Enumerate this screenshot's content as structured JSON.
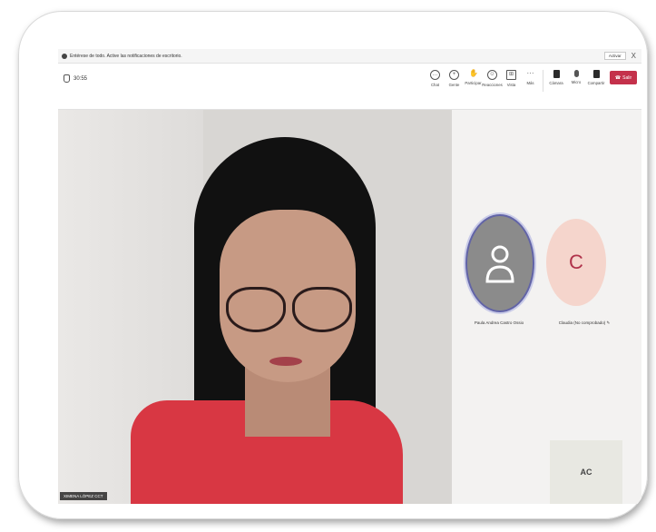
{
  "notification": {
    "text": "Entérese de todo. Active las notificaciones de escritorio.",
    "action_label": "Activar",
    "close_glyph": "X"
  },
  "call": {
    "timer": "30:55"
  },
  "toolbar": {
    "chat": "Chat",
    "raise": "Gente",
    "participants": "Participar",
    "reactions": "Reacciones",
    "view": "Vista",
    "more": "Más",
    "camera": "Cámara",
    "mic": "Micro",
    "share": "Compartir",
    "leave": "Salir"
  },
  "main_video": {
    "name_label": "XIMENA LÓPEZ CCT"
  },
  "participants": [
    {
      "name": "Paula Andrea Castro Ossio",
      "initial": ""
    },
    {
      "name": "Claudia (No comprobado)",
      "initial": "C"
    }
  ],
  "self_tile": {
    "initials": "AC"
  },
  "colors": {
    "accent": "#6264a7",
    "leave": "#c4314b"
  },
  "icons": [
    "shield-icon",
    "chat-icon",
    "people-icon",
    "hand-icon",
    "smile-icon",
    "grid-icon",
    "more-icon",
    "camera-icon",
    "mic-icon",
    "share-icon",
    "phone-icon",
    "person-icon",
    "mic-off-icon"
  ]
}
